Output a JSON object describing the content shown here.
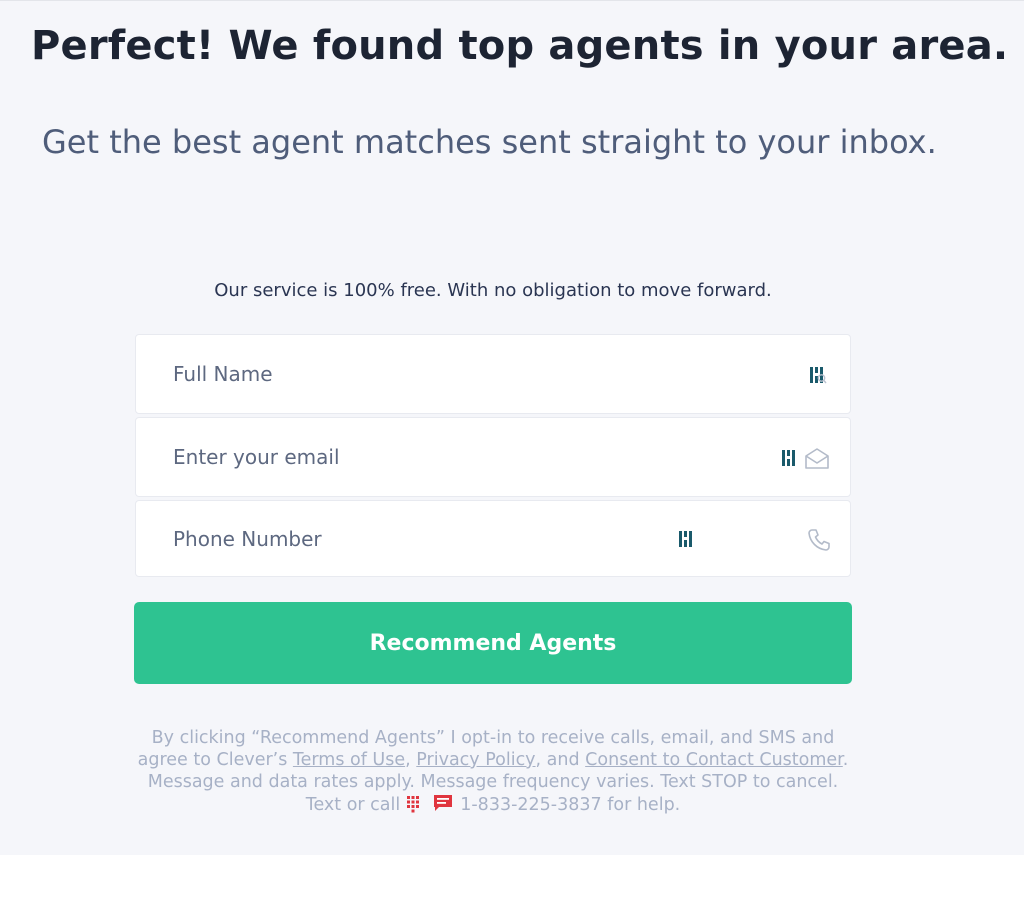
{
  "header": {
    "title": "Perfect! We found top agents in your area.",
    "subtitle": "Get the best agent matches sent straight to your inbox."
  },
  "form": {
    "note": "Our service is 100% free. With no obligation to move forward.",
    "name_placeholder": "Full Name",
    "email_placeholder": "Enter your email",
    "phone_placeholder": "Phone Number",
    "submit_label": "Recommend Agents"
  },
  "legal": {
    "line1": "By clicking “Recommend Agents” I opt-in to receive calls, email, and SMS and",
    "line2_prefix": "agree to Clever’s ",
    "terms_link": "Terms of Use",
    "sep1": ", ",
    "privacy_link": "Privacy Policy",
    "sep2": ", and ",
    "consent_link": "Consent to Contact Customer",
    "line2_suffix": ".",
    "line3": "Message and data rates apply. Message frequency varies. Text STOP to cancel.",
    "line4_prefix": "Text or call",
    "phone": "1-833-225-3837",
    "line4_suffix": " for help."
  },
  "icons": {
    "password_manager": "lastpass-icon",
    "email": "envelope-icon",
    "phone": "phone-icon",
    "keypad": "keypad-icon",
    "sms": "chat-bubble-icon"
  },
  "colors": {
    "accent": "#2ec391",
    "heading": "#1d2433",
    "subheading": "#4f5d7a",
    "legal": "#a7b1c6",
    "sms_icon": "#e0353f",
    "lastpass_icon": "#1a5a6b"
  }
}
